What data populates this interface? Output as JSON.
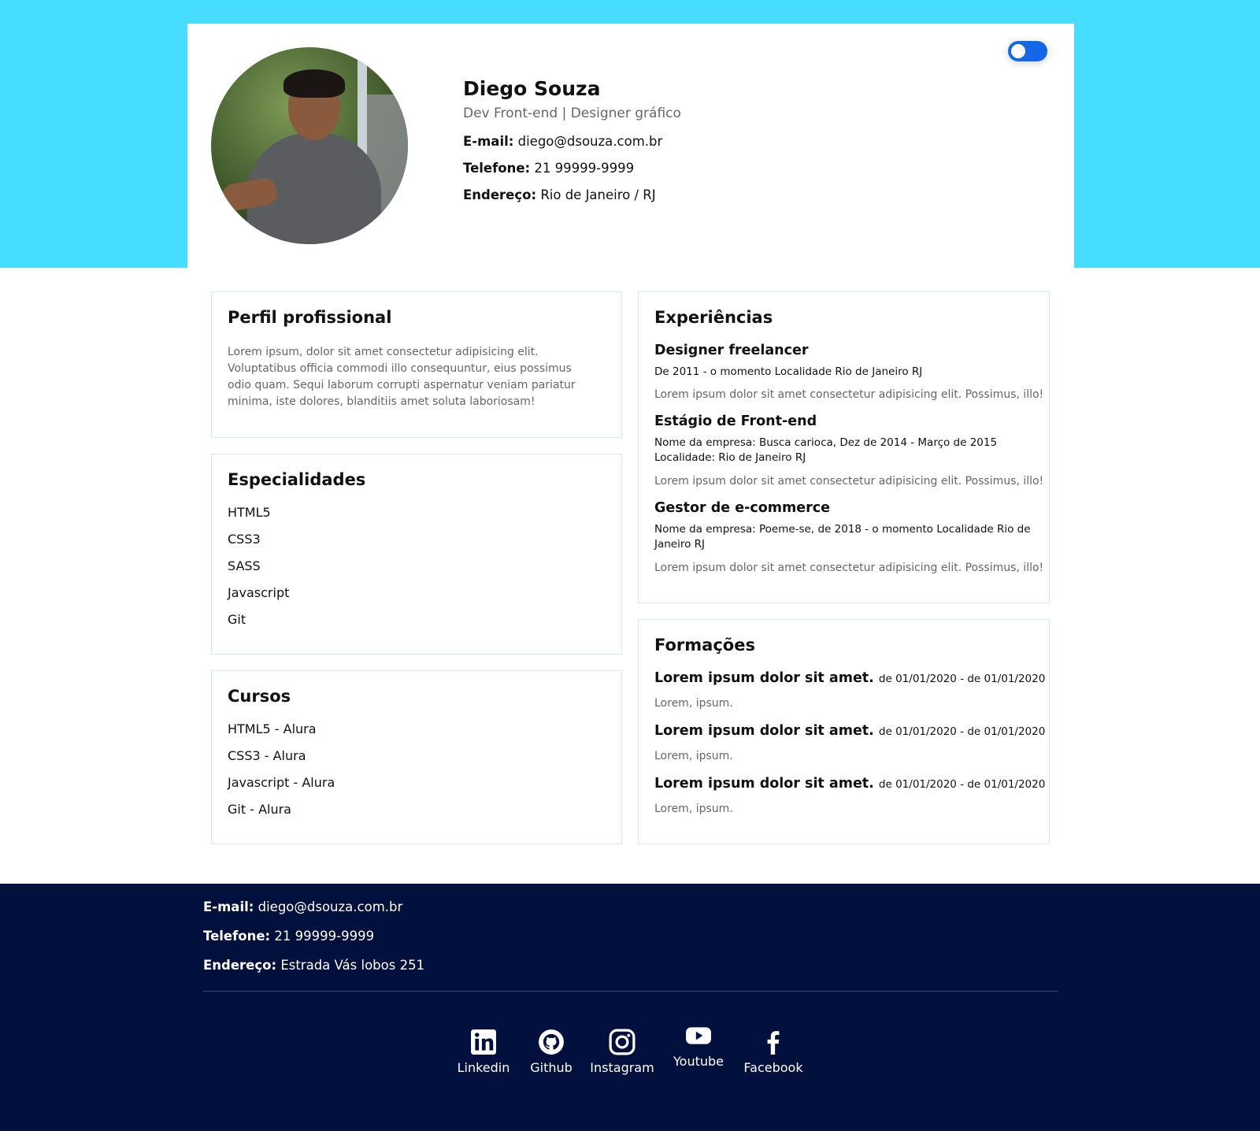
{
  "theme": {
    "accent": "#46ddfe",
    "toggle": "#1467e6",
    "footer_bg": "#02103e",
    "border": "#d6e8f5"
  },
  "header": {
    "name": "Diego Souza",
    "role": "Dev Front-end | Designer gráfico",
    "email_label": "E-mail:",
    "email": "diego@dsouza.com.br",
    "phone_label": "Telefone:",
    "phone": "21 99999-9999",
    "address_label": "Endereço:",
    "address": "Rio de Janeiro / RJ"
  },
  "perfil": {
    "title": "Perfil profissional",
    "text": "Lorem ipsum, dolor sit amet consectetur adipisicing elit. Voluptatibus officia commodi illo consequuntur, eius possimus odio quam. Sequi laborum corrupti aspernatur veniam pariatur minima, iste dolores, blanditiis amet soluta laboriosam!"
  },
  "especialidades": {
    "title": "Especialidades",
    "items": [
      "HTML5",
      "CSS3",
      "SASS",
      "Javascript",
      "Git"
    ]
  },
  "cursos": {
    "title": "Cursos",
    "items": [
      "HTML5 - Alura",
      "CSS3 - Alura",
      "Javascript - Alura",
      "Git - Alura"
    ]
  },
  "experiencias": {
    "title": "Experiências",
    "jobs": [
      {
        "title": "Designer freelancer",
        "meta": "De 2011 - o momento Localidade Rio de Janeiro RJ",
        "desc": "Lorem ipsum dolor sit amet consectetur adipisicing elit. Possimus, illo!"
      },
      {
        "title": "Estágio de Front-end",
        "meta": "Nome da empresa: Busca carioca, Dez de 2014 - Março de 2015 Localidade: Rio de Janeiro RJ",
        "desc": "Lorem ipsum dolor sit amet consectetur adipisicing elit. Possimus, illo!"
      },
      {
        "title": "Gestor de e-commerce",
        "meta": "Nome da empresa: Poeme-se, de 2018 - o momento Localidade Rio de Janeiro RJ",
        "desc": "Lorem ipsum dolor sit amet consectetur adipisicing elit. Possimus, illo!"
      }
    ]
  },
  "formacoes": {
    "title": "Formações",
    "items": [
      {
        "title": "Lorem ipsum dolor sit amet.",
        "dates": "de 01/01/2020 - de 01/01/2020",
        "desc": "Lorem, ipsum."
      },
      {
        "title": "Lorem ipsum dolor sit amet.",
        "dates": "de 01/01/2020 - de 01/01/2020",
        "desc": "Lorem, ipsum."
      },
      {
        "title": "Lorem ipsum dolor sit amet.",
        "dates": "de 01/01/2020 - de 01/01/2020",
        "desc": "Lorem, ipsum."
      }
    ]
  },
  "footer": {
    "email_label": "E-mail:",
    "email": "diego@dsouza.com.br",
    "phone_label": "Telefone:",
    "phone": "21 99999-9999",
    "address_label": "Endereço:",
    "address": "Estrada Vás lobos 251",
    "social": [
      {
        "label": "Linkedin",
        "icon": "linkedin-icon"
      },
      {
        "label": "Github",
        "icon": "github-icon"
      },
      {
        "label": "Instagram",
        "icon": "instagram-icon"
      },
      {
        "label": "Youtube",
        "icon": "youtube-icon"
      },
      {
        "label": "Facebook",
        "icon": "facebook-icon"
      }
    ]
  }
}
